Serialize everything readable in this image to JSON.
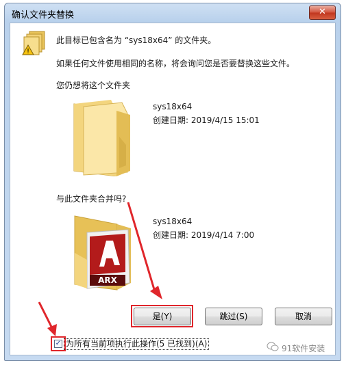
{
  "window": {
    "title": "确认文件夹替换",
    "close_label": "✕"
  },
  "message": {
    "line1": "此目标已包含名为 “sys18x64” 的文件夹。",
    "line2": "如果任何文件使用相同的名称，将会询问您是否要替换这些文件。",
    "line3": "您仍想将这个文件夹"
  },
  "existing_folder": {
    "name": "sys18x64",
    "created": "创建日期: 2019/4/15 15:01"
  },
  "merge_question": "与此文件夹合并吗?",
  "new_folder": {
    "name": "sys18x64",
    "created": "创建日期: 2019/4/14 7:00",
    "badge_text": "ARX"
  },
  "buttons": {
    "yes": "是(Y)",
    "skip": "跳过(S)",
    "cancel": "取消"
  },
  "checkbox": {
    "checked": true,
    "label": "为所有当前项执行此操作(5 已找到)(A)"
  },
  "watermark": "91软件安装",
  "colors": {
    "highlight": "#e0262b",
    "folder": "#f2cf6b"
  }
}
